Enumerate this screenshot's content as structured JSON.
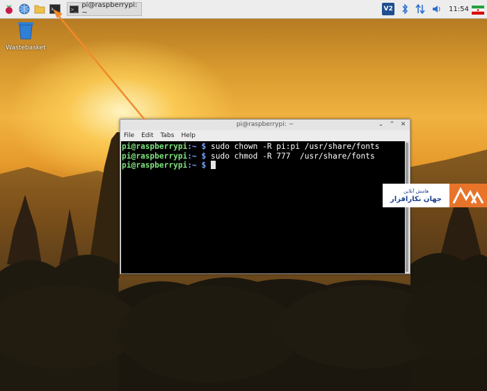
{
  "taskbar": {
    "task_label": "pi@raspberrypi: ~",
    "task_icon_glyph": ">_",
    "clock": "11:54",
    "vnc_label": "V2",
    "icons": [
      "raspberry-menu-icon",
      "web-browser-icon",
      "file-manager-icon",
      "terminal-icon",
      "bluetooth-icon",
      "network-arrows-icon",
      "volume-icon"
    ]
  },
  "desktop": {
    "wastebasket_label": "Wastebasket"
  },
  "terminal": {
    "title": "pi@raspberrypi: ~",
    "menu": [
      "File",
      "Edit",
      "Tabs",
      "Help"
    ],
    "lines": [
      {
        "user": "pi@raspberrypi",
        "path": ":~",
        "symbol": " $ ",
        "command": "sudo chown -R pi:pi /usr/share/fonts"
      },
      {
        "user": "pi@raspberrypi",
        "path": ":~",
        "symbol": " $ ",
        "command": "sudo chmod -R 777  /usr/share/fonts"
      },
      {
        "user": "pi@raspberrypi",
        "path": ":~",
        "symbol": " $ ",
        "command": ""
      }
    ]
  },
  "watermark": {
    "line1": "هامش آنلاین",
    "line2": "جهان نكارافزار"
  },
  "colors": {
    "accent_arrow": "#f08a2a",
    "prompt_user": "#7ee27e",
    "prompt_path": "#7aa2ff",
    "logo_orange": "#e8742a",
    "logo_blue": "#1d3f91"
  }
}
